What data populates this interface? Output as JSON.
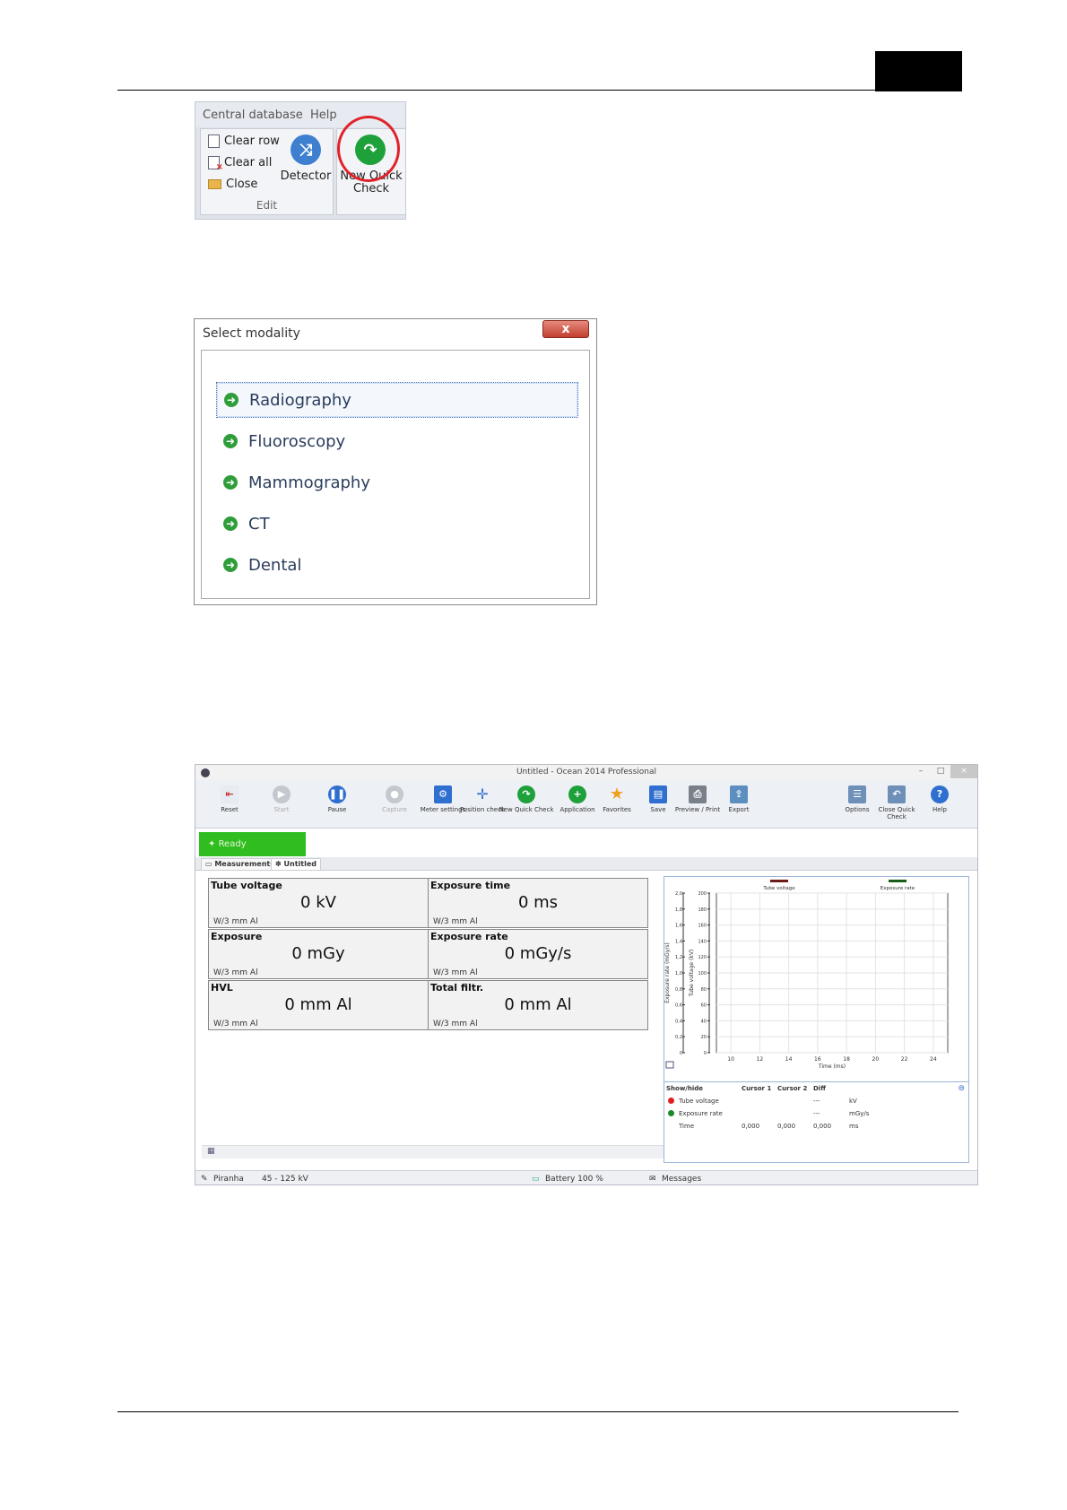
{
  "ribbon": {
    "menu": [
      "Central database",
      "Help"
    ],
    "items": {
      "clear_row": "Clear row",
      "clear_all": "Clear all",
      "close": "Close",
      "detector": "Detector",
      "new_quick_check_1": "New Quick",
      "new_quick_check_2": "Check",
      "group_label": "Edit"
    }
  },
  "dialog": {
    "title": "Select modality",
    "close_glyph": "x",
    "items": [
      "Radiography",
      "Fluoroscopy",
      "Mammography",
      "CT",
      "Dental"
    ],
    "selected": "Radiography"
  },
  "app": {
    "title": "Untitled - Ocean 2014 Professional",
    "toolbar": [
      {
        "label": "Reset",
        "icon": "reset-icon"
      },
      {
        "label": "Start",
        "icon": "play-icon"
      },
      {
        "label": "Pause",
        "icon": "pause-icon"
      },
      {
        "label": "Capture",
        "icon": "capture-icon"
      },
      {
        "label": "Meter settings",
        "icon": "meter-settings-icon"
      },
      {
        "label": "Position check",
        "icon": "crosshair-icon"
      },
      {
        "label": "New Quick Check",
        "icon": "new-quick-check-icon"
      },
      {
        "label": "Application",
        "icon": "add-icon"
      },
      {
        "label": "Favorites",
        "icon": "star-icon"
      },
      {
        "label": "Save",
        "icon": "save-icon"
      },
      {
        "label": "Preview / Print",
        "icon": "print-icon"
      },
      {
        "label": "Export",
        "icon": "export-icon"
      },
      {
        "label": "Options",
        "icon": "options-icon"
      },
      {
        "label": "Close Quick Check",
        "icon": "close-quick-check-icon"
      },
      {
        "label": "Help",
        "icon": "help-icon"
      }
    ],
    "status": "Ready",
    "tabs": [
      "Measurements",
      "Untitled"
    ],
    "measurements": [
      {
        "label": "Tube voltage",
        "value": "0 kV",
        "sub": "W/3 mm Al"
      },
      {
        "label": "Exposure time",
        "value": "0 ms",
        "sub": "W/3 mm Al"
      },
      {
        "label": "Exposure",
        "value": "0 mGy",
        "sub": "W/3 mm Al"
      },
      {
        "label": "Exposure rate",
        "value": "0 mGy/s",
        "sub": "W/3 mm Al"
      },
      {
        "label": "HVL",
        "value": "0 mm Al",
        "sub": "W/3 mm Al"
      },
      {
        "label": "Total filtr.",
        "value": "0 mm Al",
        "sub": "W/3 mm Al"
      }
    ],
    "legend_table": {
      "headers": [
        "Show/hide",
        "Cursor 1",
        "Cursor 2",
        "Diff"
      ],
      "rows": [
        {
          "name": "Tube voltage",
          "c1": "",
          "c2": "",
          "diff": "---",
          "unit": "kV",
          "color": "#e02020"
        },
        {
          "name": "Exposure rate",
          "c1": "",
          "c2": "",
          "diff": "---",
          "unit": "mGy/s",
          "color": "#1a8a2a"
        },
        {
          "name": "Time",
          "c1": "0,000",
          "c2": "0,000",
          "diff": "0,000",
          "unit": "ms",
          "color": ""
        }
      ]
    },
    "statusbar": {
      "detector": "Piranha",
      "range": "45 - 125 kV",
      "battery": "Battery 100 %",
      "messages": "Messages"
    }
  },
  "chart_data": {
    "type": "line",
    "title": "",
    "series": [
      {
        "name": "Tube voltage",
        "color": "#6b1c1c",
        "values": []
      },
      {
        "name": "Exposure rate",
        "color": "#1a5c1a",
        "values": []
      }
    ],
    "xlabel": "Time (ms)",
    "ylabel_left": "Exposure rate (mGy/s)",
    "ylabel_right": "Tube voltage (kV)",
    "x_ticks": [
      "10",
      "12",
      "14",
      "16",
      "18",
      "20",
      "22",
      "24"
    ],
    "y_left_ticks": [
      "0",
      "0,2",
      "0,4",
      "0,6",
      "0,8",
      "1,0",
      "1,2",
      "1,4",
      "1,6",
      "1,8",
      "2,0"
    ],
    "y_right_ticks": [
      "0",
      "20",
      "40",
      "60",
      "80",
      "100",
      "120",
      "140",
      "160",
      "180",
      "200"
    ],
    "xlim": [
      9,
      25
    ],
    "ylim_left": [
      0,
      2.0
    ],
    "ylim_right": [
      0,
      200
    ],
    "grid": true,
    "legend": "top"
  }
}
